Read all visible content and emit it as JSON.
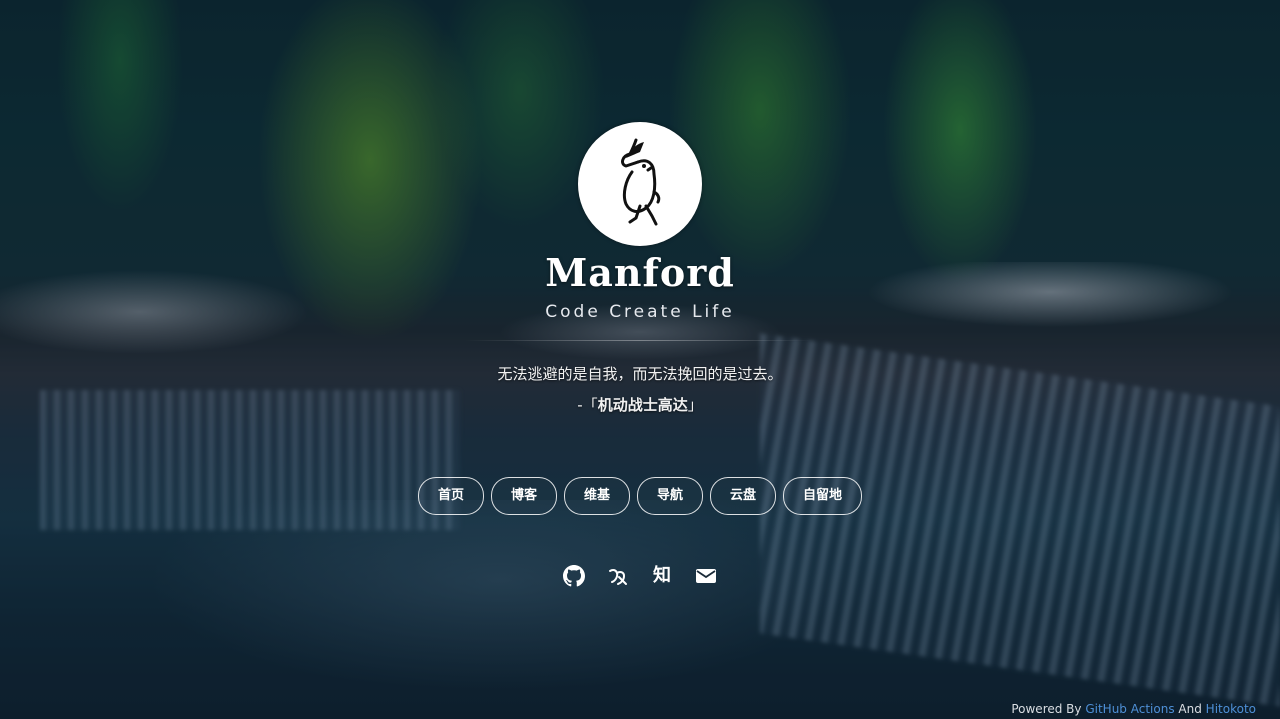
{
  "profile": {
    "name": "Manford",
    "tagline": "Code Create Life"
  },
  "quote": {
    "text": "无法逃避的是自我，而无法挽回的是过去。",
    "prefix": "-「",
    "source": "机动战士高达",
    "suffix": "」"
  },
  "nav": {
    "items": [
      {
        "label": "首页"
      },
      {
        "label": "博客"
      },
      {
        "label": "维基"
      },
      {
        "label": "导航"
      },
      {
        "label": "云盘"
      },
      {
        "label": "自留地"
      }
    ]
  },
  "social": {
    "icons": [
      "github-icon",
      "yuque-icon",
      "zhihu-icon",
      "mail-icon"
    ],
    "zhihu_glyph": "知"
  },
  "footer": {
    "powered_by": "Powered By",
    "link1": "GitHub Actions",
    "and": "And",
    "link2": "Hitokoto"
  },
  "colors": {
    "footer_link": "#4d8fd6"
  }
}
